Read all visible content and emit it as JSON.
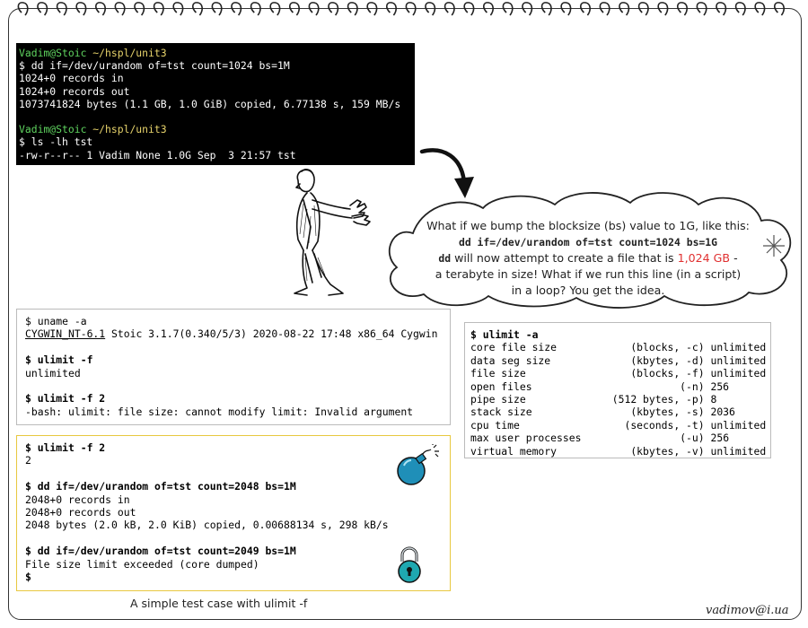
{
  "terminal": {
    "block1": {
      "prompt_user": "Vadim@Stoic",
      "prompt_path": "~/hspl/unit3",
      "command": "$ dd if=/dev/urandom of=tst count=1024 bs=1M",
      "output": [
        "1024+0 records in",
        "1024+0 records out",
        "1073741824 bytes (1.1 GB, 1.0 GiB) copied, 6.77138 s, 159 MB/s"
      ]
    },
    "block2": {
      "prompt_user": "Vadim@Stoic",
      "prompt_path": "~/hspl/unit3",
      "command": "$ ls -lh tst",
      "output": [
        "-rw-r--r-- 1 Vadim None 1.0G Sep  3 21:57 tst"
      ]
    }
  },
  "bubble": {
    "line1": "What if we bump the blocksize (bs) value to 1G, like this:",
    "command": "dd if=/dev/urandom of=tst count=1024 bs=1G",
    "line3_cmd": "dd",
    "line3_text": " will now attempt to create a file that is ",
    "line3_highlight": "1,024 GB",
    "line3_end": " -",
    "line4": "a terabyte in size! What if we run this line (in a script)",
    "line5": "in a loop? You get the idea."
  },
  "uname_box": {
    "cmd1": "$ uname -a",
    "out1_link": "CYGWIN_NT-6.1",
    "out1_rest": " Stoic 3.1.7(0.340/5/3) 2020-08-22 17:48 x86_64 Cygwin",
    "cmd2_prefix": "$ ",
    "cmd2": "ulimit -f",
    "out2": "unlimited",
    "cmd3_prefix": "$ ",
    "cmd3": "ulimit -f 2",
    "out3": "-bash: ulimit: file size: cannot modify limit: Invalid argument"
  },
  "ulimit_box": {
    "cmd": "$ ulimit -a",
    "rows": [
      {
        "name": "core file size",
        "unit": "(blocks, -c)",
        "value": "unlimited"
      },
      {
        "name": "data seg size",
        "unit": "(kbytes, -d)",
        "value": "unlimited"
      },
      {
        "name": "file size",
        "unit": "(blocks, -f)",
        "value": "unlimited"
      },
      {
        "name": "open files",
        "unit": "(-n)",
        "value": "256"
      },
      {
        "name": "pipe size",
        "unit": "(512 bytes, -p)",
        "value": "8"
      },
      {
        "name": "stack size",
        "unit": "(kbytes, -s)",
        "value": "2036"
      },
      {
        "name": "cpu time",
        "unit": "(seconds, -t)",
        "value": "unlimited"
      },
      {
        "name": "max user processes",
        "unit": "(-u)",
        "value": "256"
      },
      {
        "name": "virtual memory",
        "unit": "(kbytes, -v)",
        "value": "unlimited"
      }
    ]
  },
  "test_box": {
    "cmd1": "$ ulimit -f 2",
    "out1": "2",
    "cmd2": "$ dd if=/dev/urandom of=tst count=2048 bs=1M",
    "out2": [
      "2048+0 records in",
      "2048+0 records out",
      "2048 bytes (2.0 kB, 2.0 KiB) copied, 0.00688134 s, 298 kB/s"
    ],
    "cmd3": "$ dd if=/dev/urandom of=tst count=2049 bs=1M",
    "out3": "File size limit exceeded (core dumped)",
    "prompt": "$"
  },
  "caption": "A simple test case with ulimit -f",
  "signature": "vadimov@i.ua",
  "colors": {
    "prompt_green": "#5fd35f",
    "prompt_path": "#e7d36b",
    "highlight_red": "#e03030",
    "test_border": "#e8c840",
    "bomb_blue": "#1f8fb8",
    "lock_teal": "#1fa8b0"
  },
  "icons": [
    "spiral-binding-icon",
    "curved-arrow-icon",
    "stop-gesture-man-icon",
    "sparkle-icon",
    "bomb-icon",
    "padlock-icon"
  ]
}
